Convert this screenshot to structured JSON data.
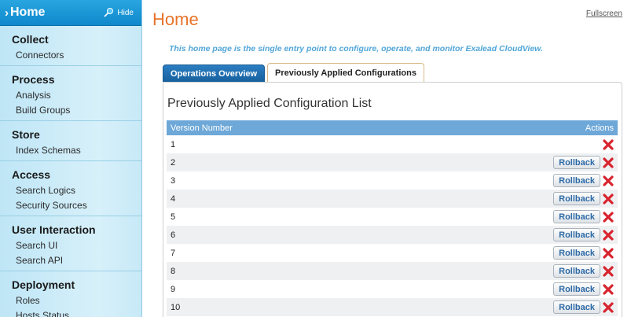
{
  "sidebar": {
    "header": {
      "title": "Home",
      "hide_label": "Hide"
    },
    "sections": [
      {
        "title": "Collect",
        "items": [
          "Connectors"
        ]
      },
      {
        "title": "Process",
        "items": [
          "Analysis",
          "Build Groups"
        ]
      },
      {
        "title": "Store",
        "items": [
          "Index Schemas"
        ]
      },
      {
        "title": "Access",
        "items": [
          "Search Logics",
          "Security Sources"
        ]
      },
      {
        "title": "User Interaction",
        "items": [
          "Search UI",
          "Search API"
        ]
      },
      {
        "title": "Deployment",
        "items": [
          "Roles",
          "Hosts Status"
        ]
      }
    ]
  },
  "main": {
    "title": "Home",
    "fullscreen_label": "Fullscreen",
    "intro": "This home page is the single entry point to configure, operate, and monitor Exalead CloudView.",
    "tabs": [
      {
        "label": "Operations Overview",
        "active": false
      },
      {
        "label": "Previously Applied Configurations",
        "active": true
      }
    ],
    "panel_title": "Previously Applied Configuration List",
    "table": {
      "headers": {
        "version": "Version Number",
        "actions": "Actions"
      },
      "rollback_label": "Rollback",
      "rows": [
        {
          "version": "1",
          "rollback": false
        },
        {
          "version": "2",
          "rollback": true
        },
        {
          "version": "3",
          "rollback": true
        },
        {
          "version": "4",
          "rollback": true
        },
        {
          "version": "5",
          "rollback": true
        },
        {
          "version": "6",
          "rollback": true
        },
        {
          "version": "7",
          "rollback": true
        },
        {
          "version": "8",
          "rollback": true
        },
        {
          "version": "9",
          "rollback": true
        },
        {
          "version": "10",
          "rollback": true
        }
      ]
    }
  },
  "colors": {
    "accent": "#e8732a",
    "brand_blue": "#1a8fd0",
    "delete": "#d8242f"
  },
  "icons": {
    "header_arrow": "chevron-right-icon",
    "hide": "pin-icon",
    "delete": "delete-x-icon"
  }
}
